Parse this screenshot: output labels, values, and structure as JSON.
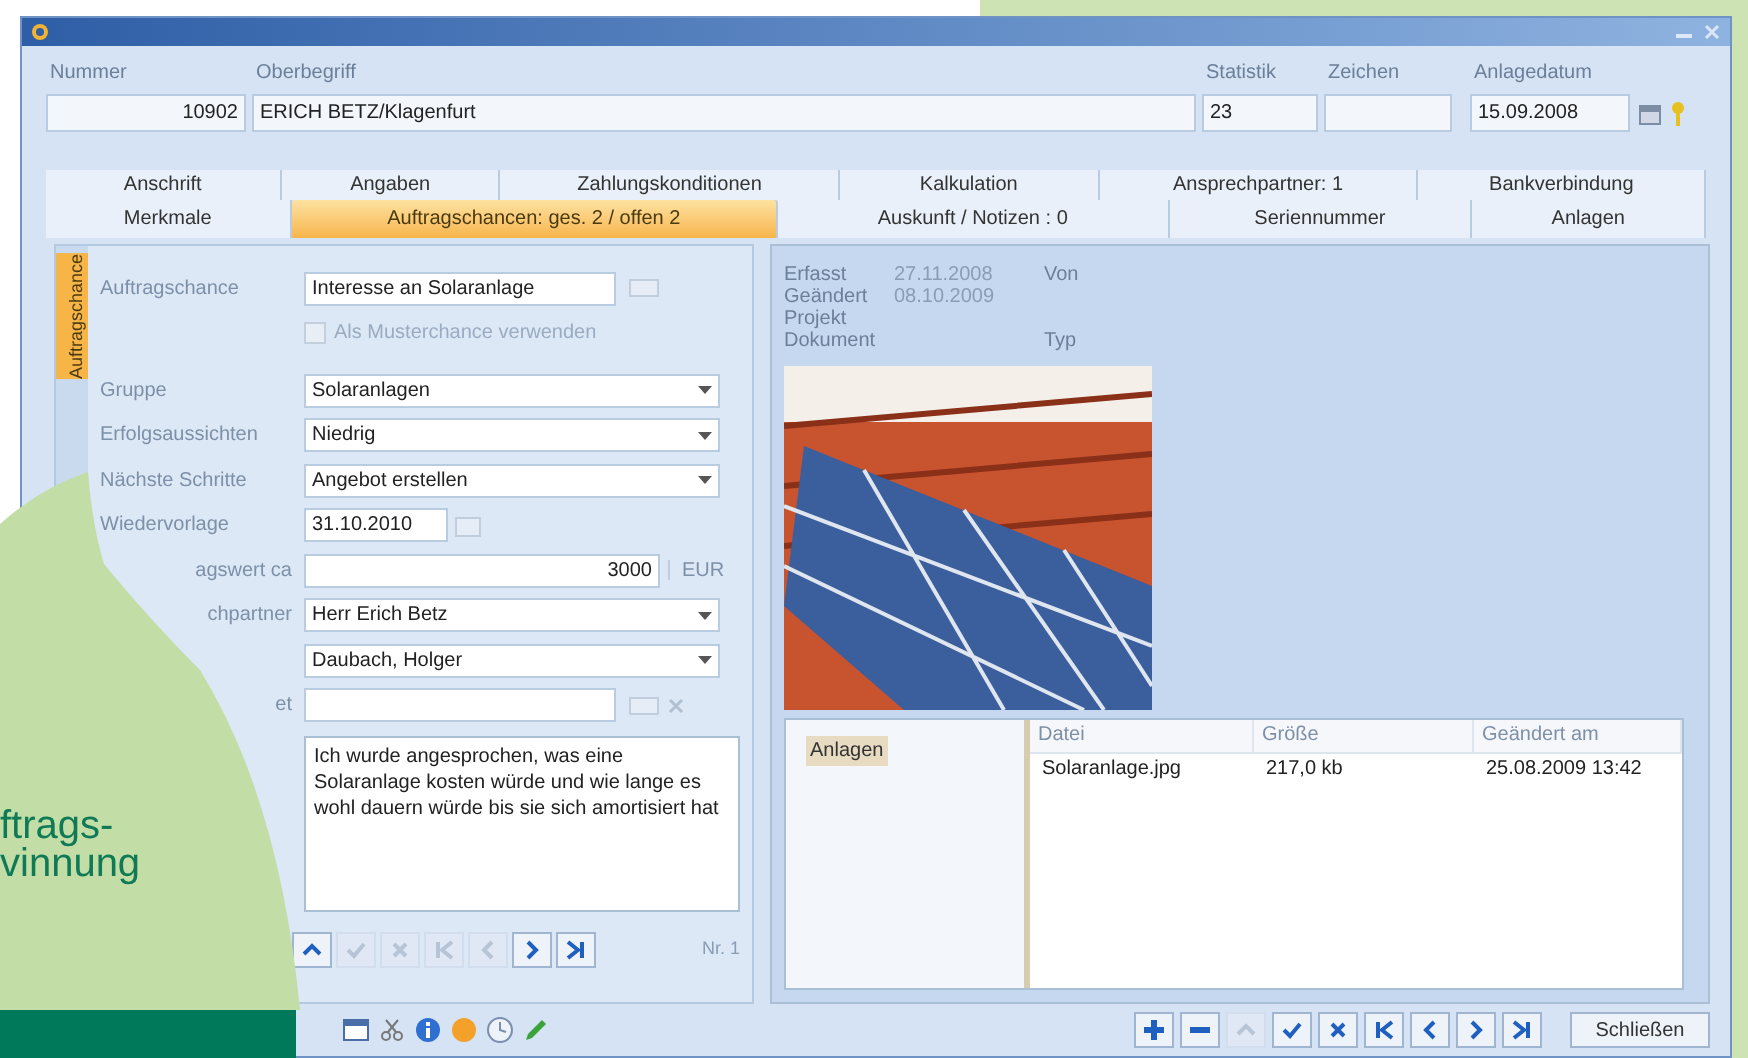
{
  "header": {
    "fields": [
      {
        "label": "Nummer",
        "value": "10902",
        "kind": "number"
      },
      {
        "label": "Oberbegriff",
        "value": "ERICH BETZ/Klagenfurt",
        "kind": "text"
      },
      {
        "label": "Statistik",
        "value": "23",
        "kind": "text"
      },
      {
        "label": "Zeichen",
        "kind": "text"
      },
      {
        "label": "Anlagedatum",
        "value": "15.09.2008",
        "kind": "date"
      }
    ]
  },
  "tabs_row_1": [
    {
      "label": "Anschrift",
      "selected": false
    },
    {
      "label": "Angaben",
      "selected": false
    },
    {
      "label": "Zahlungskonditionen",
      "selected": false
    },
    {
      "label": "Kalkulation",
      "selected": false
    },
    {
      "label": "Ansprechpartner: 1",
      "selected": false
    },
    {
      "label": "Bankverbindung",
      "selected": false
    }
  ],
  "tabs_row_2": [
    {
      "label": "Merkmale",
      "selected": false
    },
    {
      "label": "Auftragschancen: ges. 2 / offen 2",
      "selected": true
    },
    {
      "label": "Auskunft / Notizen : 0",
      "selected": false
    },
    {
      "label": "Seriennummer",
      "selected": false
    },
    {
      "label": "Anlagen",
      "selected": false
    }
  ],
  "side_tabs": [
    {
      "label": "Auftragschance",
      "selected": true
    }
  ],
  "form": {
    "rows": [
      {
        "kind": "lookup",
        "label": "Auftragschance",
        "value": "Interesse an Solaranlage"
      },
      {
        "kind": "checkbox",
        "label": "Als Musterchance verwenden",
        "checked": false,
        "disabled": true
      },
      {
        "kind": "dropdown",
        "label": "Gruppe",
        "value": "Solaranlagen"
      },
      {
        "kind": "dropdown",
        "label": "Erfolgsaussichten",
        "value": "Niedrig"
      },
      {
        "kind": "dropdown",
        "label": "Nächste Schritte",
        "value": "Angebot erstellen"
      },
      {
        "kind": "date",
        "label": "Wiedervorlage",
        "value": "31.10.2010"
      },
      {
        "kind": "amount",
        "label": "agswert ca",
        "value": "3000",
        "unit": "EUR"
      },
      {
        "kind": "dropdown",
        "label": "chpartner",
        "value": "Herr Erich Betz"
      },
      {
        "kind": "dropdown",
        "value": "Daubach, Holger"
      },
      {
        "kind": "lookup_clear",
        "label": "et"
      }
    ],
    "notes": "Ich wurde angesprochen, was eine Solaranlage kosten würde und wie lange es wohl dauern würde bis sie sich amortisiert hat",
    "nav": [
      {
        "kind": "up",
        "disabled": false
      },
      {
        "kind": "check",
        "disabled": true
      },
      {
        "kind": "cross",
        "disabled": true
      },
      {
        "kind": "first",
        "disabled": true
      },
      {
        "kind": "prev",
        "disabled": true
      },
      {
        "kind": "next",
        "disabled": false
      },
      {
        "kind": "last",
        "disabled": false
      }
    ],
    "record_number": "Nr. 1"
  },
  "info": [
    {
      "label": "Erfasst",
      "value": "27.11.2008",
      "extra_label": "Von"
    },
    {
      "label": "Geändert",
      "value": "08.10.2009"
    },
    {
      "label": "Projekt"
    },
    {
      "label": "Dokument",
      "extra_label": "Typ"
    }
  ],
  "attachments": {
    "tree": [
      {
        "label": "Anlagen",
        "selected": true
      }
    ],
    "columns": [
      "Datei",
      "Größe",
      "Geändert am"
    ],
    "rows": [
      [
        "Solaranlage.jpg",
        "217,0 kb",
        "25.08.2009 13:42"
      ]
    ]
  },
  "toolbar": {
    "nav": [
      {
        "kind": "plus",
        "disabled": false
      },
      {
        "kind": "minus",
        "disabled": false
      },
      {
        "kind": "up",
        "disabled": true
      },
      {
        "kind": "check",
        "disabled": false
      },
      {
        "kind": "cross",
        "disabled": false
      },
      {
        "kind": "first",
        "disabled": false
      },
      {
        "kind": "prev",
        "disabled": false
      },
      {
        "kind": "next",
        "disabled": false
      },
      {
        "kind": "last",
        "disabled": false
      }
    ],
    "close_button": "Schließen"
  },
  "overlay": {
    "heading_lines": [
      "ftrags-",
      "vinnung"
    ]
  }
}
